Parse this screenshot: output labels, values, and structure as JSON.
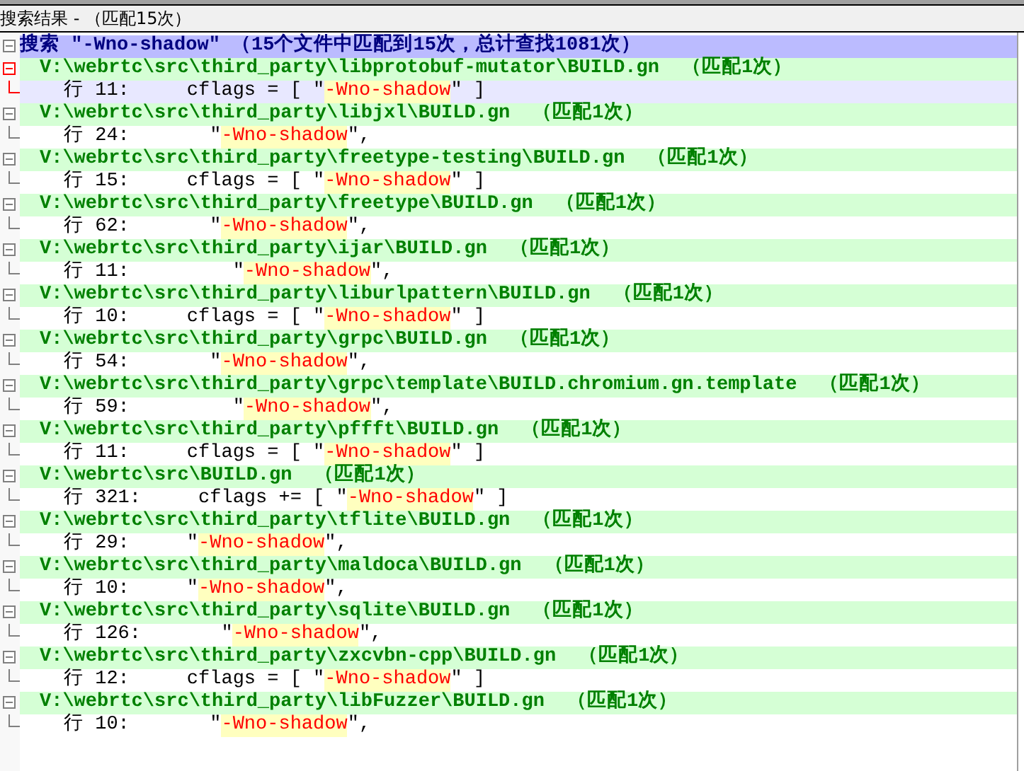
{
  "panel": {
    "title": "搜索结果 - （匹配15次）"
  },
  "search": {
    "summary": "搜索 \"-Wno-shadow\" （15个文件中匹配到15次，总计查找1081次）",
    "expanded": true
  },
  "files": [
    {
      "path": "V:\\webrtc\\src\\third_party\\libprotobuf-mutator\\BUILD.gn",
      "count": "（匹配1次）",
      "expanded": true,
      "matches": [
        {
          "line": "行 11:",
          "before": "     cflags = [ \"",
          "match": "-Wno-shadow",
          "after": "\" ]",
          "current": true
        }
      ]
    },
    {
      "path": "V:\\webrtc\\src\\third_party\\libjxl\\BUILD.gn",
      "count": "（匹配1次）",
      "expanded": true,
      "matches": [
        {
          "line": "行 24:",
          "before": "       \"",
          "match": "-Wno-shadow",
          "after": "\",",
          "current": false
        }
      ]
    },
    {
      "path": "V:\\webrtc\\src\\third_party\\freetype-testing\\BUILD.gn",
      "count": "（匹配1次）",
      "expanded": true,
      "matches": [
        {
          "line": "行 15:",
          "before": "     cflags = [ \"",
          "match": "-Wno-shadow",
          "after": "\" ]",
          "current": false
        }
      ]
    },
    {
      "path": "V:\\webrtc\\src\\third_party\\freetype\\BUILD.gn",
      "count": "（匹配1次）",
      "expanded": true,
      "matches": [
        {
          "line": "行 62:",
          "before": "       \"",
          "match": "-Wno-shadow",
          "after": "\",",
          "current": false
        }
      ]
    },
    {
      "path": "V:\\webrtc\\src\\third_party\\ijar\\BUILD.gn",
      "count": "（匹配1次）",
      "expanded": true,
      "matches": [
        {
          "line": "行 11:",
          "before": "         \"",
          "match": "-Wno-shadow",
          "after": "\",",
          "current": false
        }
      ]
    },
    {
      "path": "V:\\webrtc\\src\\third_party\\liburlpattern\\BUILD.gn",
      "count": "（匹配1次）",
      "expanded": true,
      "matches": [
        {
          "line": "行 10:",
          "before": "     cflags = [ \"",
          "match": "-Wno-shadow",
          "after": "\" ]",
          "current": false
        }
      ]
    },
    {
      "path": "V:\\webrtc\\src\\third_party\\grpc\\BUILD.gn",
      "count": "（匹配1次）",
      "expanded": true,
      "matches": [
        {
          "line": "行 54:",
          "before": "       \"",
          "match": "-Wno-shadow",
          "after": "\",",
          "current": false
        }
      ]
    },
    {
      "path": "V:\\webrtc\\src\\third_party\\grpc\\template\\BUILD.chromium.gn.template",
      "count": "（匹配1次）",
      "expanded": true,
      "matches": [
        {
          "line": "行 59:",
          "before": "         \"",
          "match": "-Wno-shadow",
          "after": "\",",
          "current": false
        }
      ]
    },
    {
      "path": "V:\\webrtc\\src\\third_party\\pffft\\BUILD.gn",
      "count": "（匹配1次）",
      "expanded": true,
      "matches": [
        {
          "line": "行 11:",
          "before": "     cflags = [ \"",
          "match": "-Wno-shadow",
          "after": "\" ]",
          "current": false
        }
      ]
    },
    {
      "path": "V:\\webrtc\\src\\BUILD.gn",
      "count": "（匹配1次）",
      "expanded": true,
      "matches": [
        {
          "line": "行 321:",
          "before": "     cflags += [ \"",
          "match": "-Wno-shadow",
          "after": "\" ]",
          "current": false
        }
      ]
    },
    {
      "path": "V:\\webrtc\\src\\third_party\\tflite\\BUILD.gn",
      "count": "（匹配1次）",
      "expanded": true,
      "matches": [
        {
          "line": "行 29:",
          "before": "     \"",
          "match": "-Wno-shadow",
          "after": "\",",
          "current": false
        }
      ]
    },
    {
      "path": "V:\\webrtc\\src\\third_party\\maldoca\\BUILD.gn",
      "count": "（匹配1次）",
      "expanded": true,
      "matches": [
        {
          "line": "行 10:",
          "before": "     \"",
          "match": "-Wno-shadow",
          "after": "\",",
          "current": false
        }
      ]
    },
    {
      "path": "V:\\webrtc\\src\\third_party\\sqlite\\BUILD.gn",
      "count": "（匹配1次）",
      "expanded": true,
      "matches": [
        {
          "line": "行 126:",
          "before": "       \"",
          "match": "-Wno-shadow",
          "after": "\",",
          "current": false
        }
      ]
    },
    {
      "path": "V:\\webrtc\\src\\third_party\\zxcvbn-cpp\\BUILD.gn",
      "count": "（匹配1次）",
      "expanded": true,
      "matches": [
        {
          "line": "行 12:",
          "before": "     cflags = [ \"",
          "match": "-Wno-shadow",
          "after": "\" ]",
          "current": false
        }
      ]
    },
    {
      "path": "V:\\webrtc\\src\\third_party\\libFuzzer\\BUILD.gn",
      "count": "（匹配1次）",
      "expanded": true,
      "matches": [
        {
          "line": "行 10:",
          "before": "       \"",
          "match": "-Wno-shadow",
          "after": "\",",
          "current": false
        }
      ]
    }
  ]
}
